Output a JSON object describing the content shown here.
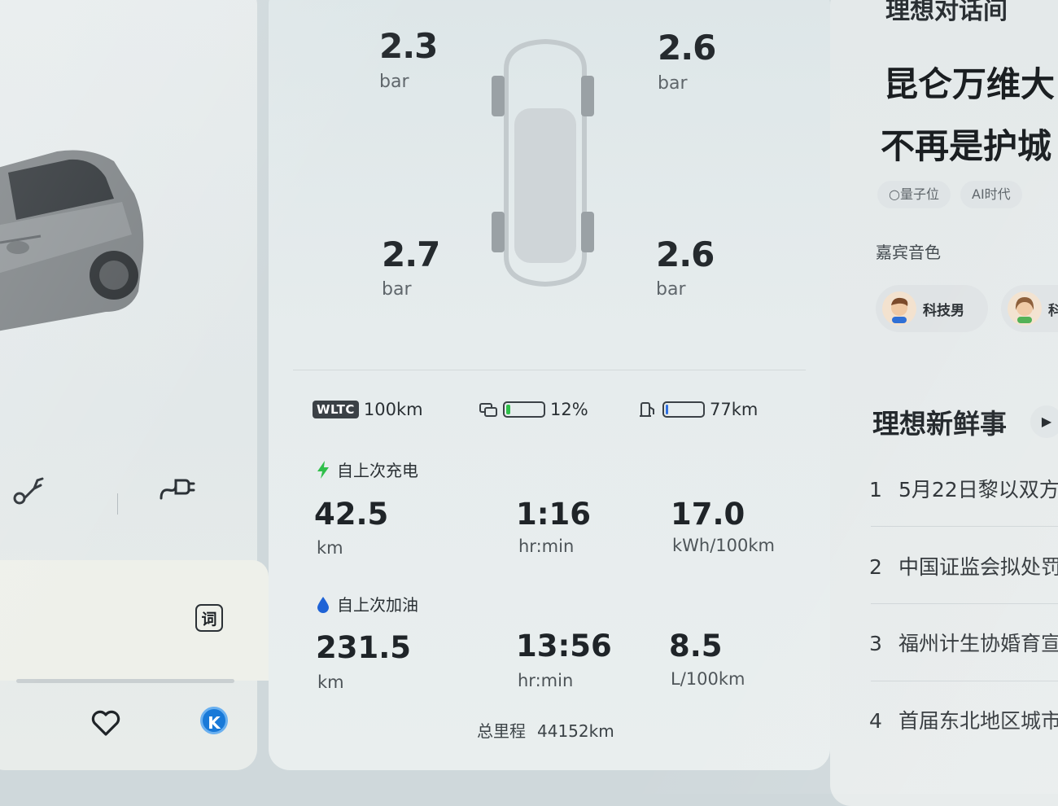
{
  "tire_pressure": {
    "front_left": {
      "value": "2.3",
      "unit": "bar"
    },
    "front_right": {
      "value": "2.6",
      "unit": "bar"
    },
    "rear_left": {
      "value": "2.7",
      "unit": "bar"
    },
    "rear_right": {
      "value": "2.6",
      "unit": "bar"
    }
  },
  "range": {
    "wltc_badge": "WLTC",
    "wltc_value": "100km",
    "battery_percent_text": "12%",
    "battery_level": 0.12,
    "fuel_range_text": "77km",
    "fuel_level": 0.06,
    "battery_fill_color": "#2fbf4a",
    "fuel_fill_color": "#2f6fe0"
  },
  "since_charge": {
    "title": "自上次充电",
    "distance": {
      "value": "42.5",
      "unit": "km"
    },
    "time": {
      "value": "1:16",
      "unit": "hr:min"
    },
    "consumption": {
      "value": "17.0",
      "unit": "kWh/100km"
    }
  },
  "since_refuel": {
    "title": "自上次加油",
    "distance": {
      "value": "231.5",
      "unit": "km"
    },
    "time": {
      "value": "13:56",
      "unit": "hr:min"
    },
    "consumption": {
      "value": "8.5",
      "unit": "L/100km"
    }
  },
  "odometer": {
    "label": "总里程",
    "value": "44152km"
  },
  "left": {
    "dictionary_icon_text": "词",
    "k_badge_text": "K"
  },
  "right": {
    "section_title": "理想对话间",
    "headline_1": "昆仑万维大",
    "headline_2": "不再是护城",
    "tag_1": "量子位",
    "tag_2": "AI时代",
    "voice_label": "嘉宾音色",
    "voice_1": "科技男",
    "voice_2": "科",
    "news_title": "理想新鲜事",
    "news": [
      {
        "num": "1",
        "text": "5月22日黎以双方"
      },
      {
        "num": "2",
        "text": "中国证监会拟处罚"
      },
      {
        "num": "3",
        "text": "福州计生协婚育宣"
      },
      {
        "num": "4",
        "text": "首届东北地区城市"
      }
    ]
  },
  "colors": {
    "accent_blue": "#1879d8",
    "charge_green": "#2fbf4a",
    "drop_blue": "#1f63d6"
  }
}
